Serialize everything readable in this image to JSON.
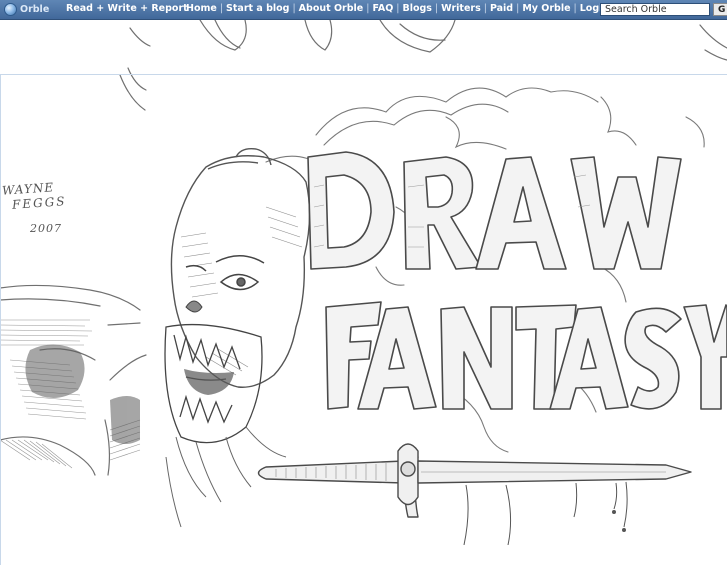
{
  "header": {
    "logo_text": "Orble",
    "tagline": "Read + Write + Report",
    "nav": [
      {
        "label": "Home"
      },
      {
        "label": "Start a blog"
      },
      {
        "label": "About Orble"
      },
      {
        "label": "FAQ"
      },
      {
        "label": "Blogs"
      },
      {
        "label": "Writers"
      },
      {
        "label": "Paid"
      },
      {
        "label": "My Orble"
      },
      {
        "label": "Login"
      }
    ],
    "separator": "|",
    "search": {
      "value": "Search Orble",
      "button_label": "G"
    }
  },
  "artwork": {
    "title_line1": "DRAW",
    "title_line2": "FANTASY",
    "signature": {
      "line1": "WAYNE",
      "line2": "FEGGS",
      "year": "2007"
    }
  },
  "colors": {
    "nav_bar": "#4f77a8",
    "pencil": "#6e6e6e",
    "paper": "#ffffff"
  },
  "icons": [
    "orble-globe-icon"
  ]
}
